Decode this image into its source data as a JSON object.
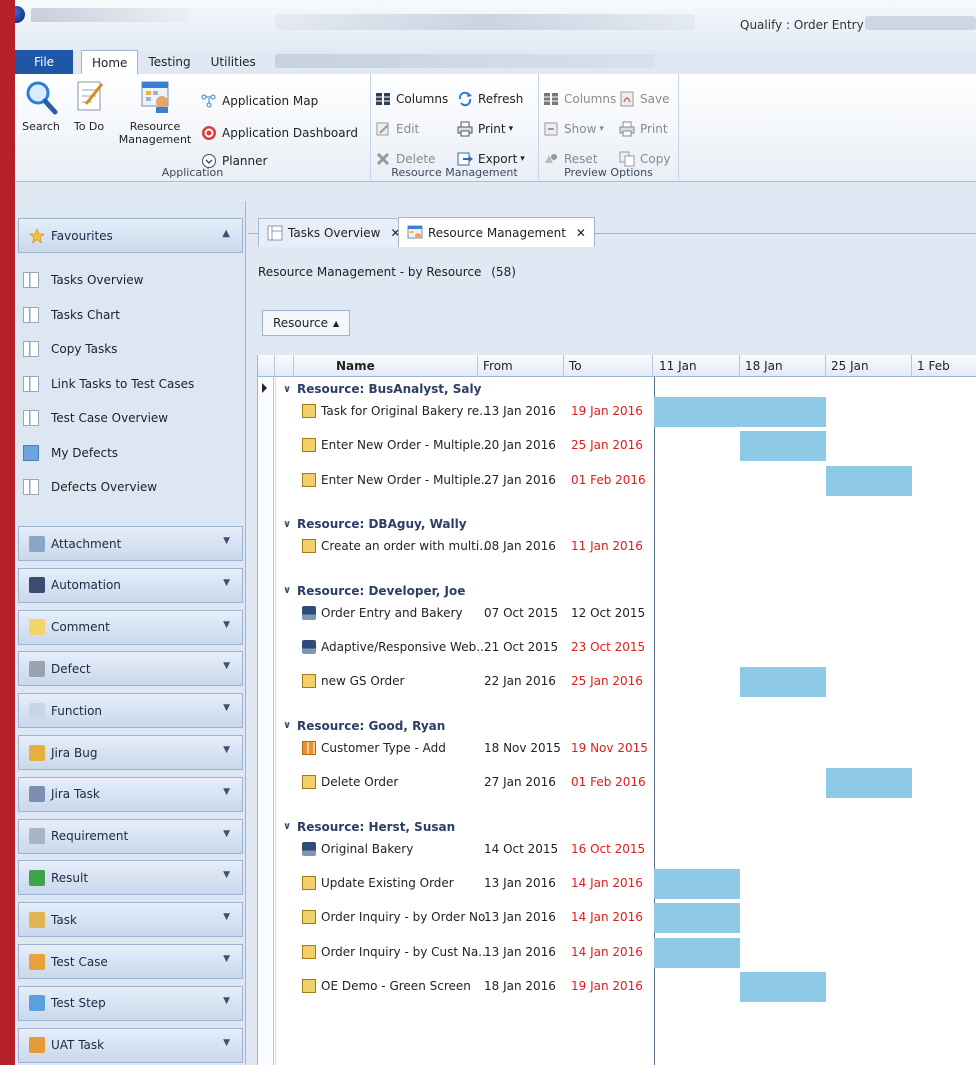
{
  "window": {
    "title": "Qualify : Order Entry"
  },
  "ribbon_tabs": [
    "File",
    "Home",
    "Testing",
    "Utilities"
  ],
  "ribbon": {
    "application": {
      "label": "Application",
      "search": "Search",
      "todo": "To Do",
      "resource_line1": "Resource",
      "resource_line2": "Management",
      "app_map": "Application Map",
      "app_dashboard": "Application Dashboard",
      "planner": "Planner"
    },
    "resource_management": {
      "label": "Resource Management",
      "columns": "Columns",
      "refresh": "Refresh",
      "edit": "Edit",
      "print": "Print",
      "delete": "Delete",
      "export": "Export"
    },
    "preview_options": {
      "label": "Preview Options",
      "columns": "Columns",
      "save": "Save",
      "show": "Show",
      "print": "Print",
      "reset": "Reset",
      "copy": "Copy"
    }
  },
  "sidebar": {
    "favourites": {
      "title": "Favourites",
      "items": [
        "Tasks Overview",
        "Tasks Chart",
        "Copy Tasks",
        "Link Tasks to Test Cases",
        "Test Case Overview",
        "My Defects",
        "Defects Overview"
      ]
    },
    "panes": [
      "Attachment",
      "Automation",
      "Comment",
      "Defect",
      "Function",
      "Jira Bug",
      "Jira Task",
      "Requirement",
      "Result",
      "Task",
      "Test Case",
      "Test Step",
      "UAT Task"
    ]
  },
  "doc_tabs": [
    "Tasks Overview",
    "Resource Management"
  ],
  "view": {
    "title": "Resource Management - by Resource",
    "count": "(58)",
    "group_by": "Resource"
  },
  "grid": {
    "columns": {
      "name": "Name",
      "from": "From",
      "to": "To"
    },
    "timeline": [
      "11 Jan",
      "18 Jan",
      "25 Jan",
      "1 Feb"
    ],
    "timeline_start": "2016-01-11",
    "groups": [
      {
        "label": "Resource: BusAnalyst, Saly",
        "tasks": [
          {
            "name": "Task for Original Bakery re...",
            "from": "13 Jan 2016",
            "to": "19 Jan 2016",
            "late": true,
            "icon": "task-icon"
          },
          {
            "name": "Enter New Order - Multiple...",
            "from": "20 Jan 2016",
            "to": "25 Jan 2016",
            "late": true,
            "icon": "task-icon"
          },
          {
            "name": "Enter New Order - Multiple...",
            "from": "27 Jan 2016",
            "to": "01 Feb 2016",
            "late": true,
            "icon": "task-icon"
          }
        ]
      },
      {
        "label": "Resource: DBAguy, Wally",
        "tasks": [
          {
            "name": "Create an order with multi...",
            "from": "08 Jan 2016",
            "to": "11 Jan 2016",
            "late": true,
            "icon": "task-icon"
          }
        ]
      },
      {
        "label": "Resource: Developer, Joe",
        "tasks": [
          {
            "name": "Order Entry and Bakery",
            "from": "07 Oct 2015",
            "to": "12 Oct 2015",
            "late": false,
            "icon": "automation-icon"
          },
          {
            "name": "Adaptive/Responsive Web...",
            "from": "21 Oct 2015",
            "to": "23 Oct 2015",
            "late": true,
            "icon": "automation-icon"
          },
          {
            "name": "new GS Order",
            "from": "22 Jan 2016",
            "to": "25 Jan 2016",
            "late": true,
            "icon": "task-icon"
          }
        ]
      },
      {
        "label": "Resource: Good, Ryan",
        "tasks": [
          {
            "name": "Customer Type - Add",
            "from": "18 Nov 2015",
            "to": "19 Nov 2015",
            "late": true,
            "icon": "uat-task-icon"
          },
          {
            "name": "Delete Order",
            "from": "27 Jan 2016",
            "to": "01 Feb 2016",
            "late": true,
            "icon": "task-icon"
          }
        ]
      },
      {
        "label": "Resource: Herst, Susan",
        "tasks": [
          {
            "name": "Original Bakery",
            "from": "14 Oct 2015",
            "to": "16 Oct 2015",
            "late": true,
            "icon": "automation-icon"
          },
          {
            "name": "Update Existing Order",
            "from": "13 Jan 2016",
            "to": "14 Jan 2016",
            "late": true,
            "icon": "task-icon"
          },
          {
            "name": "Order Inquiry - by Order No",
            "from": "13 Jan 2016",
            "to": "14 Jan 2016",
            "late": true,
            "icon": "task-icon"
          },
          {
            "name": "Order Inquiry - by Cust Na...",
            "from": "13 Jan 2016",
            "to": "14 Jan 2016",
            "late": true,
            "icon": "task-icon"
          },
          {
            "name": "OE Demo - Green Screen",
            "from": "18 Jan 2016",
            "to": "19 Jan 2016",
            "late": true,
            "icon": "task-icon"
          }
        ]
      }
    ]
  },
  "colors": {
    "gantt_bar": "#8ecae6",
    "late_date": "#e21b1b",
    "file_tab": "#1f56a8",
    "side_bar": "#b5212a"
  }
}
